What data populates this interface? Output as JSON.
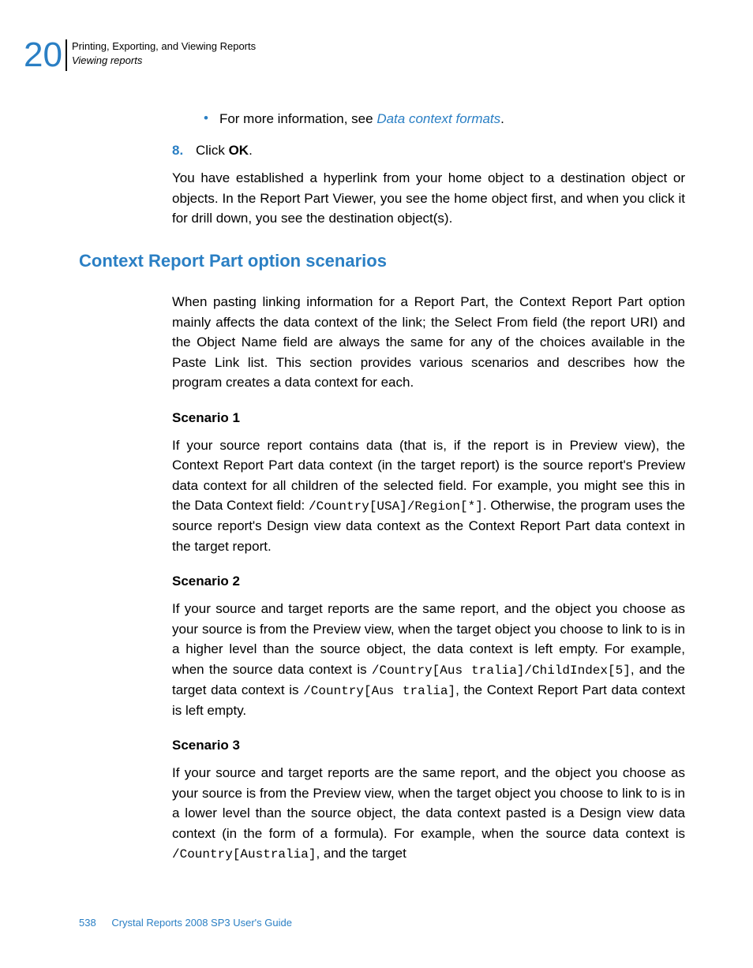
{
  "header": {
    "chapter_number": "20",
    "chapter_title": "Printing, Exporting, and Viewing Reports",
    "section_title": "Viewing reports"
  },
  "bullet": {
    "prefix": "For more information, see ",
    "link": "Data context formats",
    "suffix": "."
  },
  "step": {
    "num": "8.",
    "text_before": "Click ",
    "text_bold": "OK",
    "text_after": "."
  },
  "para1": "You have established a hyperlink from your home object to a destination object or objects. In the Report Part Viewer, you see the home object first, and when you click it for drill down, you see the destination object(s).",
  "heading2": "Context Report Part option scenarios",
  "para2": "When pasting linking information for a Report Part, the Context Report Part option mainly affects the data context of the link; the Select From field (the report URI) and the Object Name field are always the same for any of the choices available in the Paste Link list. This section provides various scenarios and describes how the program creates a data context for each.",
  "scenario1": {
    "title": "Scenario 1",
    "p_a": "If your source report contains data (that is, if the report is in Preview view), the Context Report Part data context (in the target report) is the source report's Preview data context for all children of the selected field. For example, you might see this in the Data Context field: ",
    "code_a": "/Country[USA]/Region[*]",
    "p_b": ". Otherwise, the program uses the source report's Design view data context as the Context Report Part data context in the target report."
  },
  "scenario2": {
    "title": "Scenario 2",
    "p_a": "If your source and target reports are the same report, and the object you choose as your source is from the Preview view, when the target object you choose to link to is in a higher level than the source object, the data context is left empty. For example, when the source data context is ",
    "code_a": "/Country[Aus tralia]/ChildIndex[5]",
    "p_b": ", and the target data context is ",
    "code_b": "/Country[Aus tralia]",
    "p_c": ", the Context Report Part data context is left empty."
  },
  "scenario3": {
    "title": "Scenario 3",
    "p_a": "If your source and target reports are the same report, and the object you choose as your source is from the Preview view, when the target object you choose to link to is in a lower level than the source object, the data context pasted is a Design view data context (in the form of a formula). For example, when the source data context is ",
    "code_a": "/Country[Australia]",
    "p_b": ", and the target"
  },
  "footer": {
    "page": "538",
    "doc": "Crystal Reports 2008 SP3 User's Guide"
  }
}
